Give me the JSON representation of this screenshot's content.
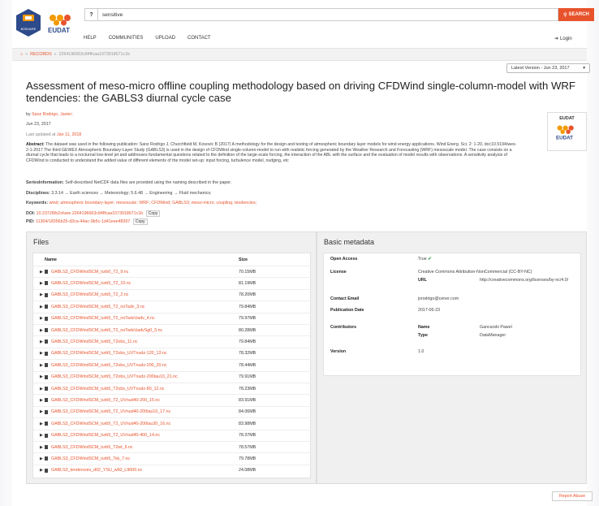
{
  "header": {
    "logo_b2share_text": "B2SHARE",
    "logo_eudat_text": "EUDAT",
    "search_value": "sensitive",
    "search_button": "SEARCH",
    "nav": [
      "HELP",
      "COMMUNITIES",
      "UPLOAD",
      "CONTACT"
    ],
    "login": "Login"
  },
  "breadcrumb": {
    "records": "RECORDS",
    "sep": "»",
    "id": "2264196663c84ffcaa1073918671c1b"
  },
  "version_select": "Latest Version - Jun 23, 2017",
  "record": {
    "title": "Assessment of meso-micro offline coupling methodology based on driving CFDWind single-column-model with WRF tendencies: the GABLS3 diurnal cycle case",
    "by_label": "by",
    "author": "Sanz Rodrigo, Javier;",
    "date": "Jun 23, 2017",
    "updated_label": "Last updated at",
    "updated": "Jan 11, 2018",
    "abstract_label": "Abstract:",
    "abstract": "The dataset was used in the following publication: Sanz Rodrigo J, Churchfield M, Kosovic B (2017) A methodology for the design and testing of atmospheric boundary layer models for wind energy applications. Wind Energ. Sci. 2: 1-20, doi:10.5194/wes-2-1-2017 The third GEWEX Atmospheric Boundary-Layer Study (GABLS3) is used in the design of CFDWind single-column-model to run with realistic forcing generated by the Weather Research and Forecasting (WRF) mesoscale model. The case consists on a diurnal cycle that leads to a nocturnal low-level jet and addresses fundamental questions related to the definition of the large-scale forcing, the interaction of the ABL with the surface and the evaluation of model results with observations. A sensitivity analysis of CFDWind is conducted to understand the added value of different elements of the model set-up: input forcing, turbulence model, nudging, etc",
    "series_label": "SeriesInformation:",
    "series": "Self-described NetCDF data files are provided using the naming described in the paper.",
    "disciplines_label": "Disciplines:",
    "disciplines": "3.3.14 → Earth sciences → Meteorology; 5.6.48 → Engineering → Fluid mechanics;",
    "keywords_label": "Keywords:",
    "keywords": "wind; atmospheric boundary-layer; mesoscale; WRF; CFDWind; GABLS3; meso-micro; coupling; tendencies;",
    "doi_label": "DOI:",
    "doi": "10.23728/b2share.2264196663c84ffcaa1073918671c1b",
    "pid_label": "PID:",
    "pid": "11304/18356b25-d3ca-44ac-9b5c-1d41eee48307",
    "copy": "Copy",
    "badge_label": "EUDAT"
  },
  "files": {
    "title": "Files",
    "col_name": "Name",
    "col_size": "Size",
    "rows": [
      {
        "name": "GABLS3_CFDWindSCM_turb0_T2_9.nc",
        "size": "70.15MB"
      },
      {
        "name": "GABLS3_CFDWindSCM_turb5_T2_10.nc",
        "size": "81.19MB"
      },
      {
        "name": "GABLS3_CFDWindSCM_turb5_T2_2.nc",
        "size": "78.20MB"
      },
      {
        "name": "GABLS3_CFDWindSCM_turb5_T2_noTadv_3.nc",
        "size": "79.84MB"
      },
      {
        "name": "GABLS3_CFDWindSCM_turb5_T2_noTadvUadv_4.nc",
        "size": "79.97MB"
      },
      {
        "name": "GABLS3_CFDWindSCM_turb5_T2_noTadvUadvSg0_5.nc",
        "size": "80.28MB"
      },
      {
        "name": "GABLS3_CFDWindSCM_turb5_T2obs_11.nc",
        "size": "79.84MB"
      },
      {
        "name": "GABLS3_CFDWindSCM_turb5_T2obs_UVTnudz-120_13.nc",
        "size": "78.32MB"
      },
      {
        "name": "GABLS3_CFDWindSCM_turb5_T2obs_UVTnudz-200_20.nc",
        "size": "78.44MB"
      },
      {
        "name": "GABLS3_CFDWindSCM_turb5_T2obs_UVTnudz-200tau10_21.nc",
        "size": "79.91MB"
      },
      {
        "name": "GABLS3_CFDWindSCM_turb5_T2obs_UVTnudz-80_12.nc",
        "size": "78.23MB"
      },
      {
        "name": "GABLS3_CFDWindSCM_turb5_T2_UVnud40-200_15.nc",
        "size": "83.91MB"
      },
      {
        "name": "GABLS3_CFDWindSCM_turb5_T2_UVnud40-200tau10_17.nc",
        "size": "84.06MB"
      },
      {
        "name": "GABLS3_CFDWindSCM_turb5_T2_UVnud40-200tau30_16.nc",
        "size": "83.98MB"
      },
      {
        "name": "GABLS3_CFDWindSCM_turb5_T2_UVnud40-400_14.nc",
        "size": "78.37MB"
      },
      {
        "name": "GABLS3_CFDWindSCM_turb5_T2wt_6.nc",
        "size": "78.57MB"
      },
      {
        "name": "GABLS3_CFDWindSCM_turb5_Tsk_7.nc",
        "size": "79.78MB"
      },
      {
        "name": "GABLS3_tendencies_d02_YSU_w60_L9000.nc",
        "size": "24.08MB"
      }
    ]
  },
  "basic_metadata": {
    "title": "Basic metadata",
    "open_access_label": "Open Access",
    "open_access": "True",
    "license_label": "License",
    "license": "Creative Commons Attribution-NonCommercial (CC-BY-NC)",
    "url_label": "URL",
    "url": "http://creativecommons.org/licenses/by-nc/4.0/",
    "contact_label": "Contact Email",
    "contact": "jsrodrigo@cener.com",
    "pubdate_label": "Publication Date",
    "pubdate": "2017-06-23",
    "contributors_label": "Contributors",
    "name_label": "Name",
    "name": "Gancarski Pawel",
    "type_label": "Type",
    "type": "DataManager",
    "version_label": "Version",
    "version": "1.0"
  },
  "report_abuse": "Report Abuse",
  "colors": {
    "accent": "#e8532c",
    "b2share_blue": "#2d4a8a",
    "eudat_orange": "#f29a00"
  }
}
